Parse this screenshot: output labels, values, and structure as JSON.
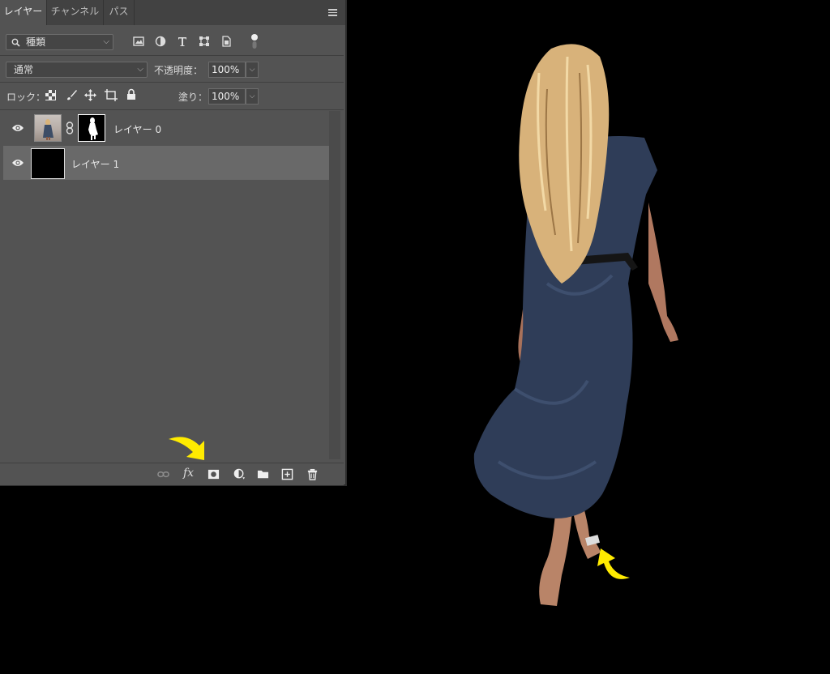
{
  "tabs": [
    {
      "label": "レイヤー",
      "active": true
    },
    {
      "label": "チャンネル",
      "active": false
    },
    {
      "label": "パス",
      "active": false
    }
  ],
  "filter": {
    "kind_label": "種類",
    "icons": [
      "image-filter-icon",
      "adjustment-filter-icon",
      "type-filter-icon",
      "shape-filter-icon",
      "smart-object-filter-icon",
      "filter-toggle-icon"
    ]
  },
  "blend": {
    "mode": "通常",
    "opacity_label": "不透明度：",
    "opacity": "100%"
  },
  "lock": {
    "label": "ロック：",
    "fill_label": "塗り：",
    "fill": "100%"
  },
  "layers": [
    {
      "name": "レイヤー 0",
      "visible": true,
      "selected": false,
      "has_mask": true
    },
    {
      "name": "レイヤー 1",
      "visible": true,
      "selected": true,
      "has_mask": false
    }
  ],
  "bottom_icons": [
    "link-layers-icon",
    "fx-icon",
    "add-mask-icon",
    "adjustment-layer-icon",
    "new-group-icon",
    "new-layer-icon",
    "delete-layer-icon"
  ],
  "fx_label": "fx",
  "colors": {
    "panel": "#535353",
    "selected_row": "#696969",
    "arrow": "#ffeb00"
  }
}
